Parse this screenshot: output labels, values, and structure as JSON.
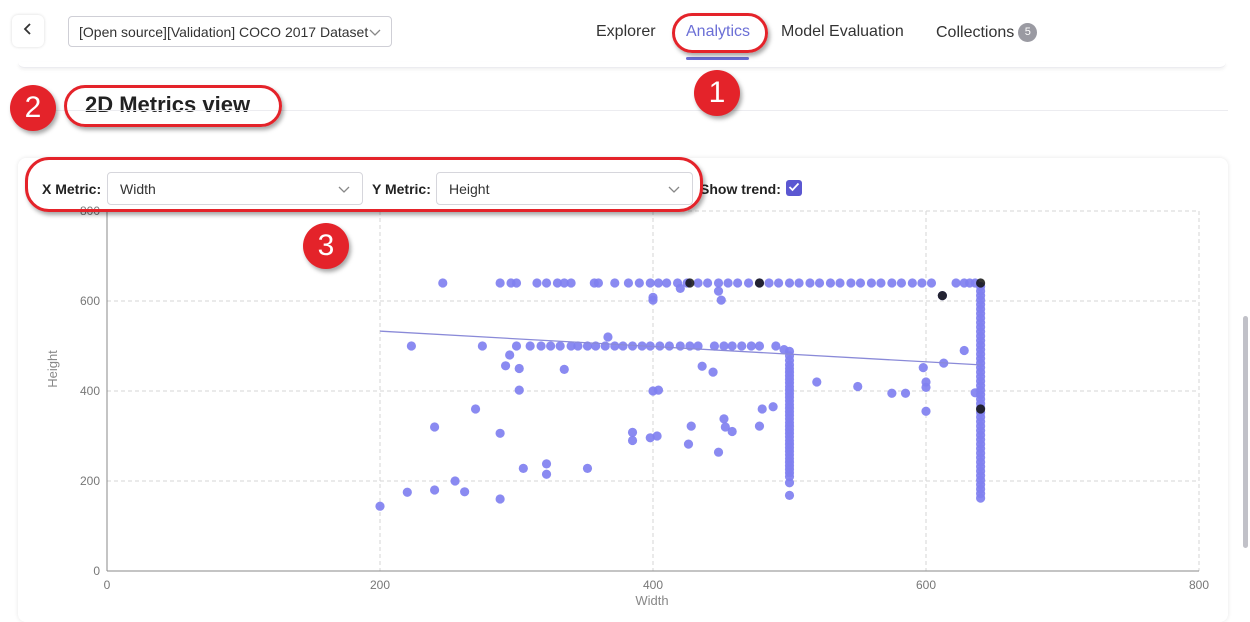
{
  "header": {
    "dataset_selector": "[Open source][Validation] COCO 2017 Dataset",
    "tabs": [
      {
        "label": "Explorer"
      },
      {
        "label": "Analytics"
      },
      {
        "label": "Model Evaluation"
      },
      {
        "label": "Collections",
        "badge": "5"
      }
    ],
    "active_tab": "Analytics"
  },
  "section": {
    "title": "2D Metrics view"
  },
  "controls": {
    "x_metric_label": "X Metric:",
    "x_metric_value": "Width",
    "y_metric_label": "Y Metric:",
    "y_metric_value": "Height",
    "show_trend_label": "Show trend:",
    "show_trend_checked": true
  },
  "annotations": {
    "one": "1",
    "two": "2",
    "three": "3"
  },
  "colors": {
    "accent": "#6b6fd6",
    "point": "#8080f0",
    "highlight": "#e4232a"
  },
  "chart_data": {
    "type": "scatter",
    "xlabel": "Width",
    "ylabel": "Height",
    "xlim": [
      0,
      800
    ],
    "ylim": [
      0,
      800
    ],
    "xticks": [
      "0",
      "200",
      "400",
      "600",
      "800"
    ],
    "yticks": [
      "0",
      "200",
      "400",
      "600",
      "800"
    ],
    "grid": true,
    "trend": {
      "x": [
        200,
        640
      ],
      "y": [
        533,
        458
      ]
    },
    "highlighted": [
      [
        427,
        640
      ],
      [
        612,
        612
      ],
      [
        640,
        640
      ],
      [
        478,
        640
      ],
      [
        640,
        360
      ]
    ],
    "points": [
      [
        246,
        640
      ],
      [
        288,
        640
      ],
      [
        296,
        640
      ],
      [
        300,
        640
      ],
      [
        315,
        640
      ],
      [
        322,
        640
      ],
      [
        330,
        640
      ],
      [
        335,
        640
      ],
      [
        340,
        640
      ],
      [
        357,
        640
      ],
      [
        360,
        640
      ],
      [
        372,
        640
      ],
      [
        382,
        640
      ],
      [
        390,
        640
      ],
      [
        398,
        640
      ],
      [
        404,
        640
      ],
      [
        410,
        640
      ],
      [
        418,
        640
      ],
      [
        425,
        640
      ],
      [
        433,
        640
      ],
      [
        440,
        640
      ],
      [
        448,
        640
      ],
      [
        455,
        640
      ],
      [
        462,
        640
      ],
      [
        470,
        640
      ],
      [
        478,
        640
      ],
      [
        485,
        640
      ],
      [
        492,
        640
      ],
      [
        500,
        640
      ],
      [
        507,
        640
      ],
      [
        515,
        640
      ],
      [
        522,
        640
      ],
      [
        530,
        640
      ],
      [
        537,
        640
      ],
      [
        545,
        640
      ],
      [
        552,
        640
      ],
      [
        560,
        640
      ],
      [
        567,
        640
      ],
      [
        575,
        640
      ],
      [
        582,
        640
      ],
      [
        590,
        640
      ],
      [
        597,
        640
      ],
      [
        604,
        640
      ],
      [
        622,
        640
      ],
      [
        628,
        640
      ],
      [
        632,
        640
      ],
      [
        636,
        640
      ],
      [
        400,
        608
      ],
      [
        400,
        602
      ],
      [
        420,
        628
      ],
      [
        448,
        622
      ],
      [
        450,
        602
      ],
      [
        612,
        612
      ],
      [
        223,
        500
      ],
      [
        275,
        500
      ],
      [
        295,
        480
      ],
      [
        300,
        500
      ],
      [
        310,
        500
      ],
      [
        318,
        500
      ],
      [
        325,
        500
      ],
      [
        332,
        500
      ],
      [
        340,
        500
      ],
      [
        345,
        500
      ],
      [
        352,
        500
      ],
      [
        358,
        500
      ],
      [
        365,
        500
      ],
      [
        372,
        500
      ],
      [
        378,
        500
      ],
      [
        385,
        500
      ],
      [
        392,
        500
      ],
      [
        398,
        500
      ],
      [
        405,
        500
      ],
      [
        412,
        500
      ],
      [
        420,
        500
      ],
      [
        427,
        500
      ],
      [
        433,
        500
      ],
      [
        445,
        500
      ],
      [
        452,
        500
      ],
      [
        458,
        500
      ],
      [
        465,
        500
      ],
      [
        472,
        500
      ],
      [
        478,
        500
      ],
      [
        490,
        500
      ],
      [
        496,
        492
      ],
      [
        367,
        520
      ],
      [
        292,
        456
      ],
      [
        302,
        450
      ],
      [
        335,
        448
      ],
      [
        436,
        455
      ],
      [
        444,
        442
      ],
      [
        613,
        462
      ],
      [
        628,
        490
      ],
      [
        598,
        452
      ],
      [
        600,
        420
      ],
      [
        600,
        408
      ],
      [
        585,
        395
      ],
      [
        575,
        395
      ],
      [
        550,
        410
      ],
      [
        520,
        420
      ],
      [
        400,
        400
      ],
      [
        404,
        402
      ],
      [
        270,
        360
      ],
      [
        302,
        402
      ],
      [
        240,
        320
      ],
      [
        288,
        306
      ],
      [
        385,
        308
      ],
      [
        385,
        290
      ],
      [
        398,
        296
      ],
      [
        403,
        300
      ],
      [
        428,
        322
      ],
      [
        426,
        282
      ],
      [
        448,
        264
      ],
      [
        452,
        338
      ],
      [
        453,
        320
      ],
      [
        458,
        310
      ],
      [
        478,
        322
      ],
      [
        480,
        360
      ],
      [
        488,
        365
      ],
      [
        600,
        355
      ],
      [
        305,
        228
      ],
      [
        322,
        238
      ],
      [
        322,
        215
      ],
      [
        352,
        228
      ],
      [
        255,
        200
      ],
      [
        262,
        176
      ],
      [
        240,
        180
      ],
      [
        220,
        175
      ],
      [
        288,
        160
      ],
      [
        200,
        144
      ],
      [
        500,
        488
      ],
      [
        500,
        478
      ],
      [
        500,
        468
      ],
      [
        500,
        458
      ],
      [
        500,
        450
      ],
      [
        500,
        442
      ],
      [
        500,
        434
      ],
      [
        500,
        426
      ],
      [
        500,
        418
      ],
      [
        500,
        410
      ],
      [
        500,
        402
      ],
      [
        500,
        394
      ],
      [
        500,
        386
      ],
      [
        500,
        378
      ],
      [
        500,
        370
      ],
      [
        500,
        362
      ],
      [
        500,
        354
      ],
      [
        500,
        346
      ],
      [
        500,
        338
      ],
      [
        500,
        330
      ],
      [
        500,
        322
      ],
      [
        500,
        314
      ],
      [
        500,
        306
      ],
      [
        500,
        298
      ],
      [
        500,
        290
      ],
      [
        500,
        282
      ],
      [
        500,
        274
      ],
      [
        500,
        266
      ],
      [
        500,
        258
      ],
      [
        500,
        250
      ],
      [
        500,
        242
      ],
      [
        500,
        234
      ],
      [
        500,
        226
      ],
      [
        500,
        218
      ],
      [
        500,
        210
      ],
      [
        500,
        196
      ],
      [
        500,
        168
      ],
      [
        640,
        632
      ],
      [
        640,
        622
      ],
      [
        640,
        612
      ],
      [
        640,
        602
      ],
      [
        640,
        592
      ],
      [
        640,
        582
      ],
      [
        640,
        572
      ],
      [
        640,
        562
      ],
      [
        640,
        552
      ],
      [
        640,
        542
      ],
      [
        640,
        532
      ],
      [
        640,
        522
      ],
      [
        640,
        512
      ],
      [
        640,
        502
      ],
      [
        640,
        492
      ],
      [
        640,
        482
      ],
      [
        640,
        472
      ],
      [
        640,
        462
      ],
      [
        640,
        452
      ],
      [
        640,
        442
      ],
      [
        640,
        432
      ],
      [
        640,
        422
      ],
      [
        640,
        412
      ],
      [
        640,
        402
      ],
      [
        640,
        392
      ],
      [
        640,
        382
      ],
      [
        640,
        372
      ],
      [
        640,
        362
      ],
      [
        640,
        352
      ],
      [
        640,
        342
      ],
      [
        640,
        332
      ],
      [
        640,
        322
      ],
      [
        640,
        312
      ],
      [
        640,
        302
      ],
      [
        640,
        292
      ],
      [
        640,
        282
      ],
      [
        640,
        272
      ],
      [
        640,
        262
      ],
      [
        640,
        252
      ],
      [
        640,
        242
      ],
      [
        640,
        232
      ],
      [
        640,
        222
      ],
      [
        640,
        212
      ],
      [
        640,
        202
      ],
      [
        640,
        192
      ],
      [
        640,
        182
      ],
      [
        640,
        172
      ],
      [
        640,
        162
      ],
      [
        636,
        396
      ]
    ]
  }
}
